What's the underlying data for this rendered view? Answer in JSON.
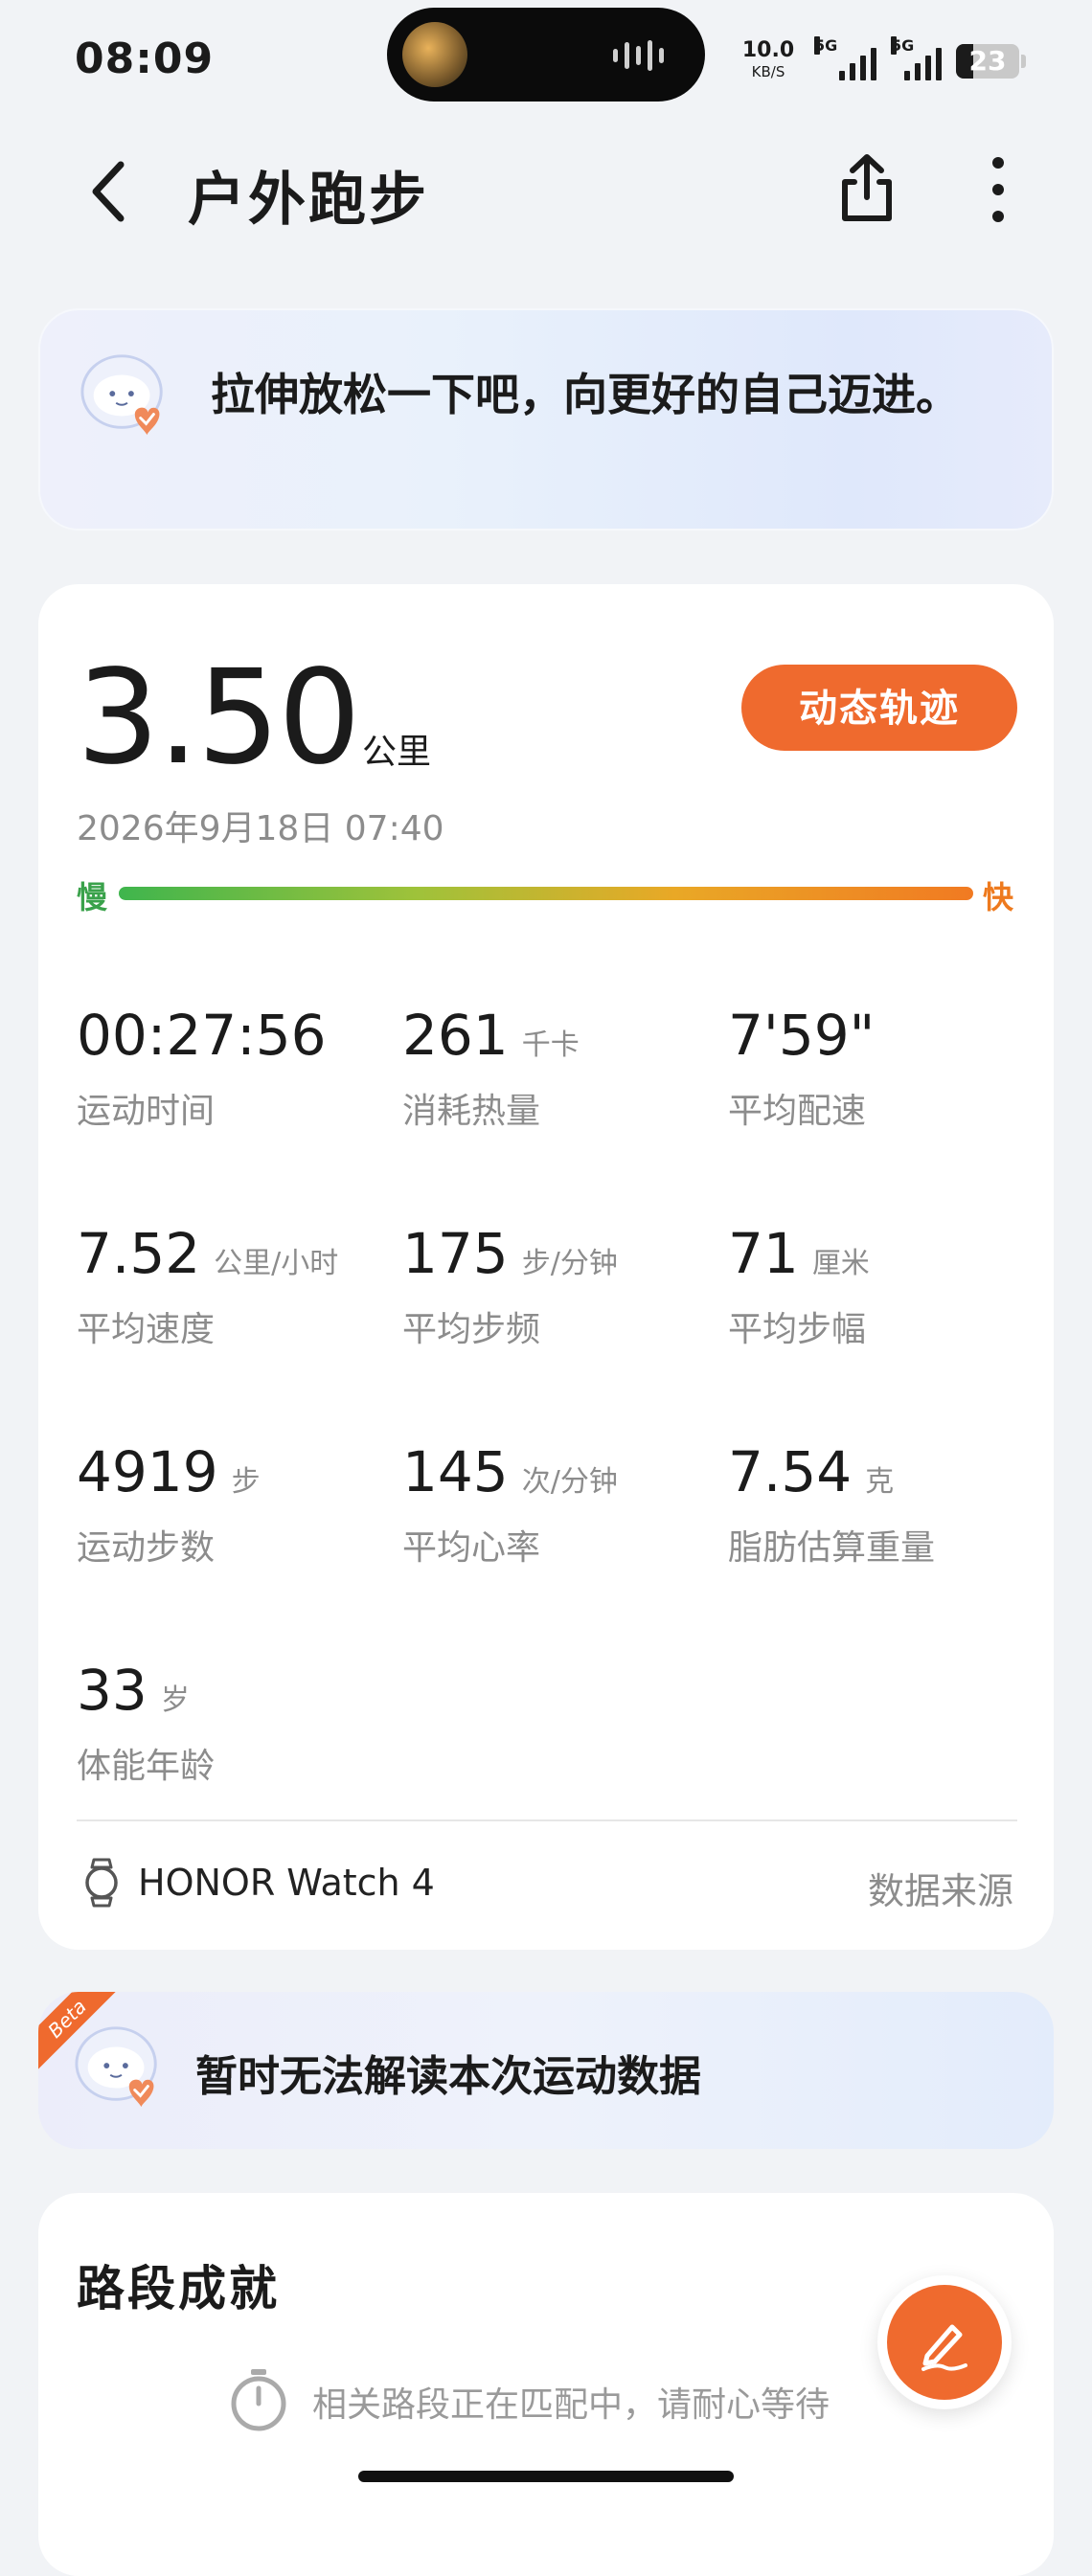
{
  "status_bar": {
    "time": "08:09",
    "net_speed_value": "10.0",
    "net_speed_unit": "KB/S",
    "sim1_label": "5G",
    "sim2_label": "5G",
    "battery_level": "23"
  },
  "header": {
    "title": "户外跑步",
    "back_icon": "chevron-left-icon",
    "share_icon": "share-icon",
    "more_icon": "more-vertical-icon"
  },
  "tip": {
    "text": "拉伸放松一下吧，向更好的自己迈进。"
  },
  "summary": {
    "distance": "3.50",
    "distance_unit": "公里",
    "track_button": "动态轨迹",
    "date": "2026年9月18日 07:40",
    "pace_slow": "慢",
    "pace_fast": "快"
  },
  "stats": [
    {
      "value": "00:27:56",
      "unit": "",
      "label": "运动时间"
    },
    {
      "value": "261",
      "unit": "千卡",
      "label": "消耗热量"
    },
    {
      "value": "7'59\"",
      "unit": "",
      "label": "平均配速"
    },
    {
      "value": "7.52",
      "unit": "公里/小时",
      "label": "平均速度"
    },
    {
      "value": "175",
      "unit": "步/分钟",
      "label": "平均步频"
    },
    {
      "value": "71",
      "unit": "厘米",
      "label": "平均步幅"
    },
    {
      "value": "4919",
      "unit": "步",
      "label": "运动步数"
    },
    {
      "value": "145",
      "unit": "次/分钟",
      "label": "平均心率"
    },
    {
      "value": "7.54",
      "unit": "克",
      "label": "脂肪估算重量"
    },
    {
      "value": "33",
      "unit": "岁",
      "label": "体能年龄"
    }
  ],
  "device": {
    "name": "HONOR Watch 4",
    "source_label": "数据来源"
  },
  "analysis": {
    "badge": "Beta",
    "text": "暂时无法解读本次运动数据"
  },
  "segments": {
    "title": "路段成就",
    "status": "相关路段正在匹配中，请耐心等待"
  },
  "colors": {
    "accent": "#ef6a2e",
    "pace_slow": "#3fb54d",
    "pace_fast": "#f17a22"
  }
}
